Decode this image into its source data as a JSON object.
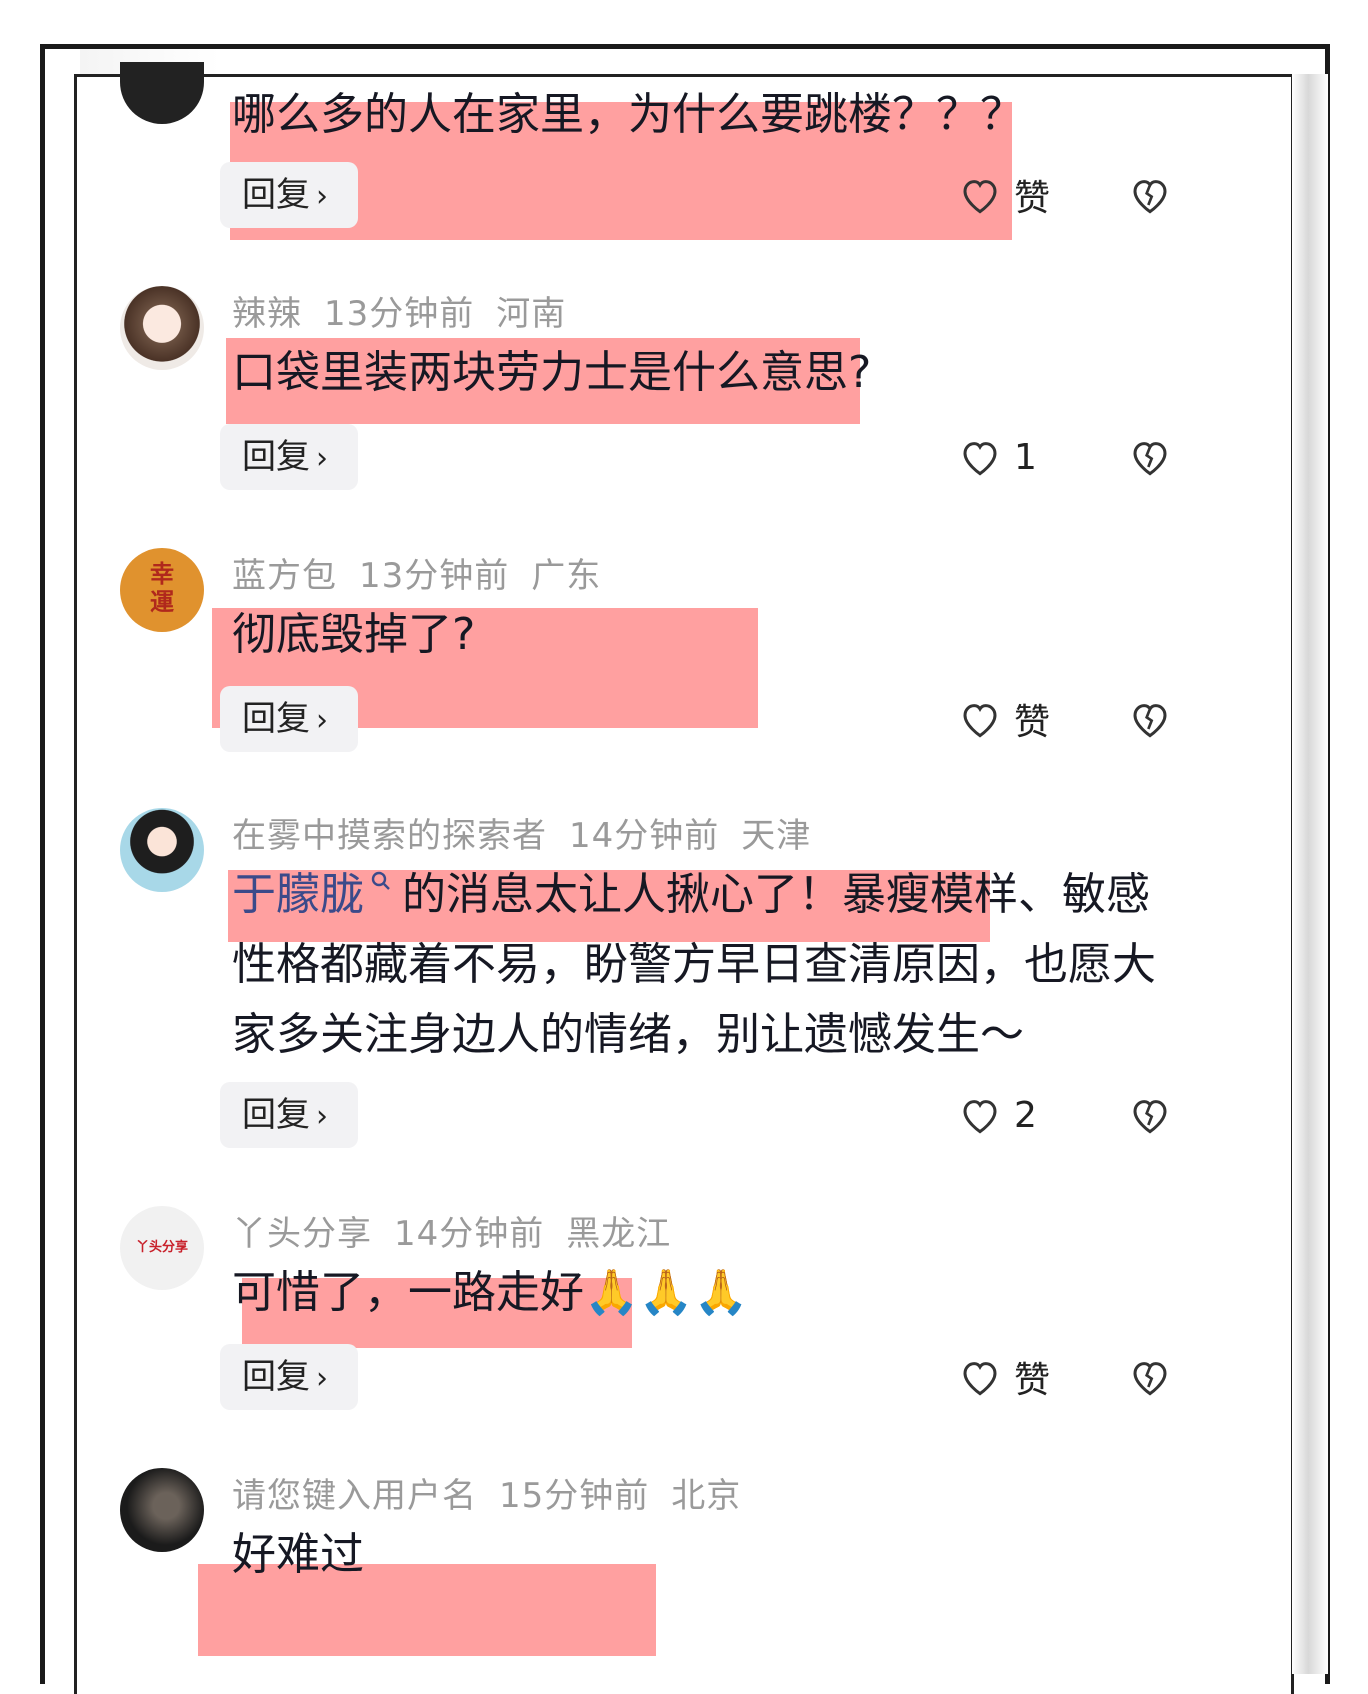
{
  "comments": [
    {
      "user": "",
      "time": "",
      "loc": "",
      "text": "哪么多的人在家里，为什么要跳楼？？？",
      "likes": "赞"
    },
    {
      "user": "辣辣",
      "time": "13分钟前",
      "loc": "河南",
      "text": "口袋里装两块劳力士是什么意思?",
      "likes": "1"
    },
    {
      "user": "蓝方包",
      "time": "13分钟前",
      "loc": "广东",
      "text": "彻底毁掉了?",
      "likes": "赞",
      "avatar_text": "幸運"
    },
    {
      "user": "在雾中摸索的探索者",
      "time": "14分钟前",
      "loc": "天津",
      "link": "于朦胧",
      "text": "的消息太让人揪心了！暴瘦模样、敏感性格都藏着不易，盼警方早日查清原因，也愿大家多关注身边人的情绪，别让遗憾发生～",
      "likes": "2"
    },
    {
      "user": "丫头分享",
      "time": "14分钟前",
      "loc": "黑龙江",
      "text": "可惜了，一路走好🙏🙏🙏",
      "likes": "赞",
      "avatar_text": "丫头分享"
    },
    {
      "user": "请您键入用户名",
      "time": "15分钟前",
      "loc": "北京",
      "text": "好难过"
    }
  ],
  "reply_label": "回复",
  "chevron": "›",
  "colors": {
    "highlight": "#ff6666",
    "meta": "#9a9a9a",
    "text": "#161823"
  }
}
